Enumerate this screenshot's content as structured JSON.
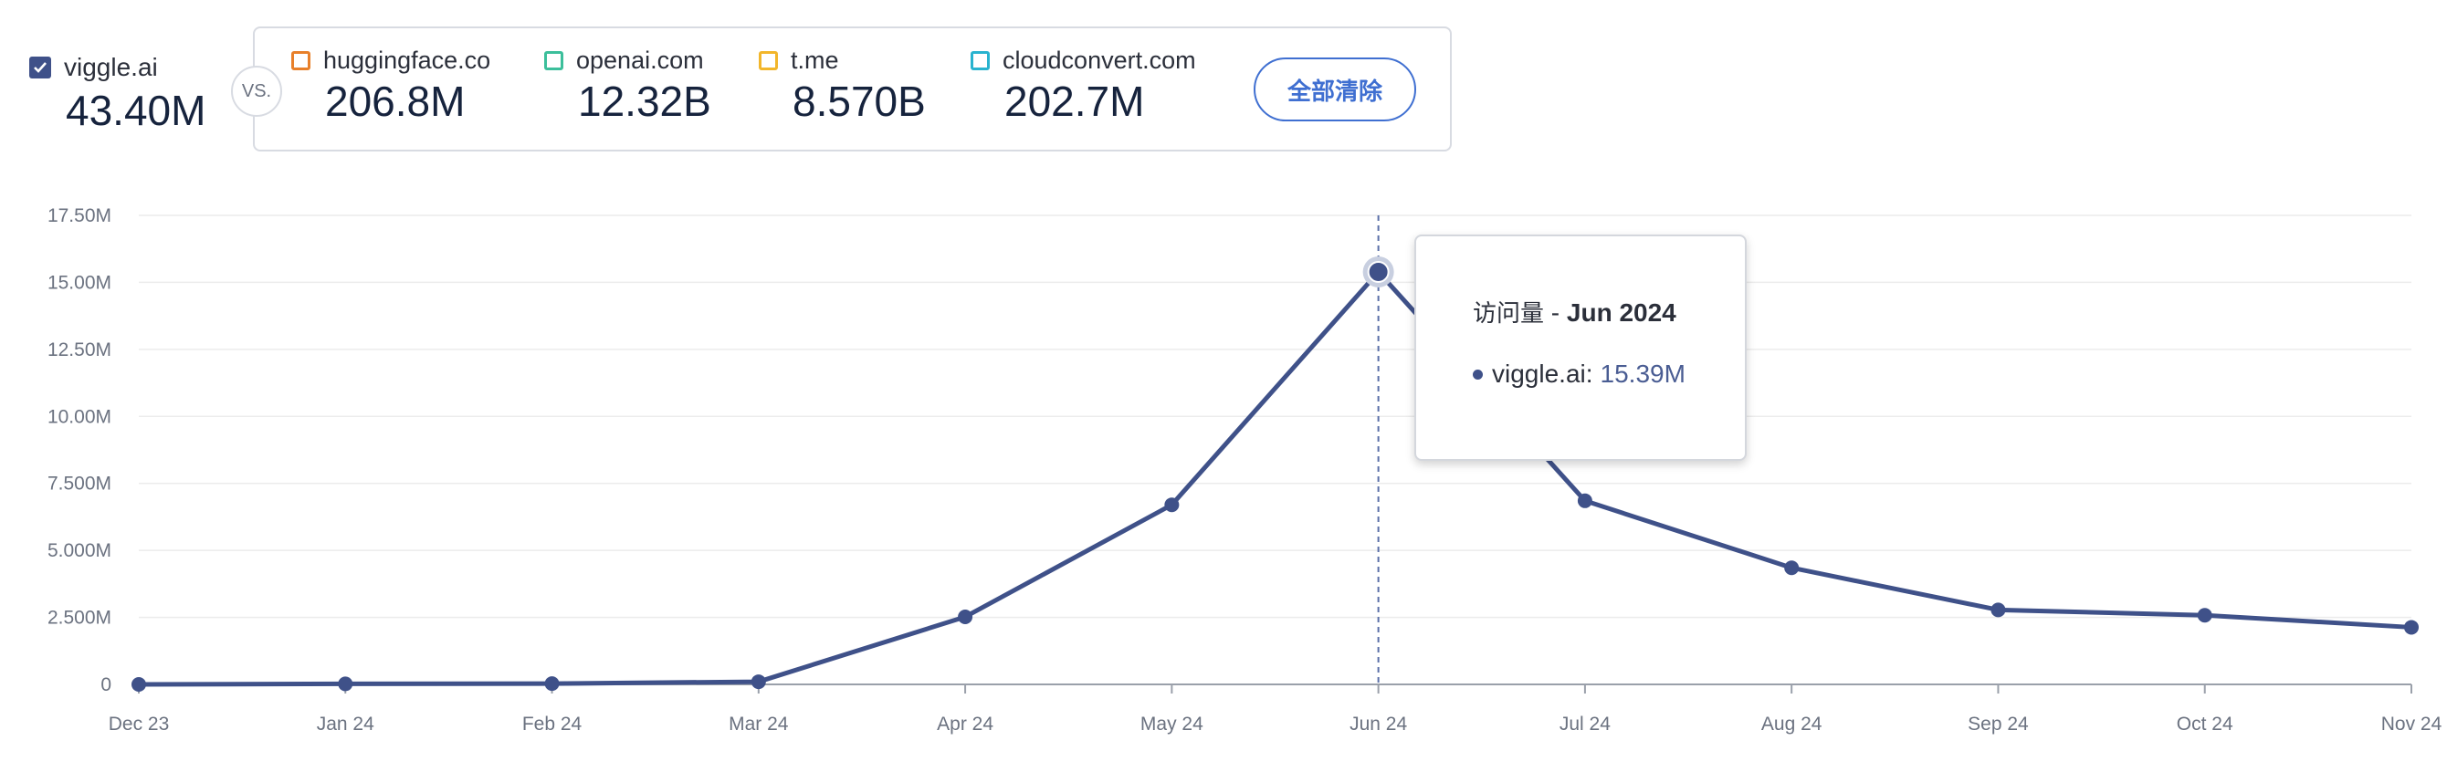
{
  "primary_site": {
    "name": "viggle.ai",
    "value": "43.40M",
    "checked": true
  },
  "vs_label": "VS.",
  "compare_sites": [
    {
      "name": "huggingface.co",
      "value": "206.8M",
      "color": "#e8802a"
    },
    {
      "name": "openai.com",
      "value": "12.32B",
      "color": "#3cbf9b"
    },
    {
      "name": "t.me",
      "value": "8.570B",
      "color": "#f2b62b"
    },
    {
      "name": "cloudconvert.com",
      "value": "202.7M",
      "color": "#29b3cf"
    }
  ],
  "clear_all_label": "全部清除",
  "tooltip": {
    "metric": "访问量",
    "separator": " - ",
    "month": "Jun 2024",
    "series_label": "viggle.ai:",
    "value": "15.39M"
  },
  "chart_data": {
    "type": "line",
    "categories": [
      "Dec 23",
      "Jan 24",
      "Feb 24",
      "Mar 24",
      "Apr 24",
      "May 24",
      "Jun 24",
      "Jul 24",
      "Aug 24",
      "Sep 24",
      "Oct 24",
      "Nov 24"
    ],
    "series": [
      {
        "name": "viggle.ai",
        "color": "#3f5189",
        "values": [
          0.0,
          0.02,
          0.03,
          0.1,
          2.52,
          6.7,
          15.39,
          6.85,
          4.35,
          2.78,
          2.58,
          2.13
        ]
      }
    ],
    "unit": "M",
    "ylim": [
      0,
      17.5
    ],
    "yticks": [
      {
        "value": 0,
        "label": "0"
      },
      {
        "value": 2.5,
        "label": "2.500M"
      },
      {
        "value": 5,
        "label": "5.000M"
      },
      {
        "value": 7.5,
        "label": "7.500M"
      },
      {
        "value": 10,
        "label": "10.00M"
      },
      {
        "value": 12.5,
        "label": "12.50M"
      },
      {
        "value": 15,
        "label": "15.00M"
      },
      {
        "value": 17.5,
        "label": "17.50M"
      }
    ],
    "highlight_index": 6,
    "grid": true,
    "title": "",
    "xlabel": "",
    "ylabel": ""
  }
}
